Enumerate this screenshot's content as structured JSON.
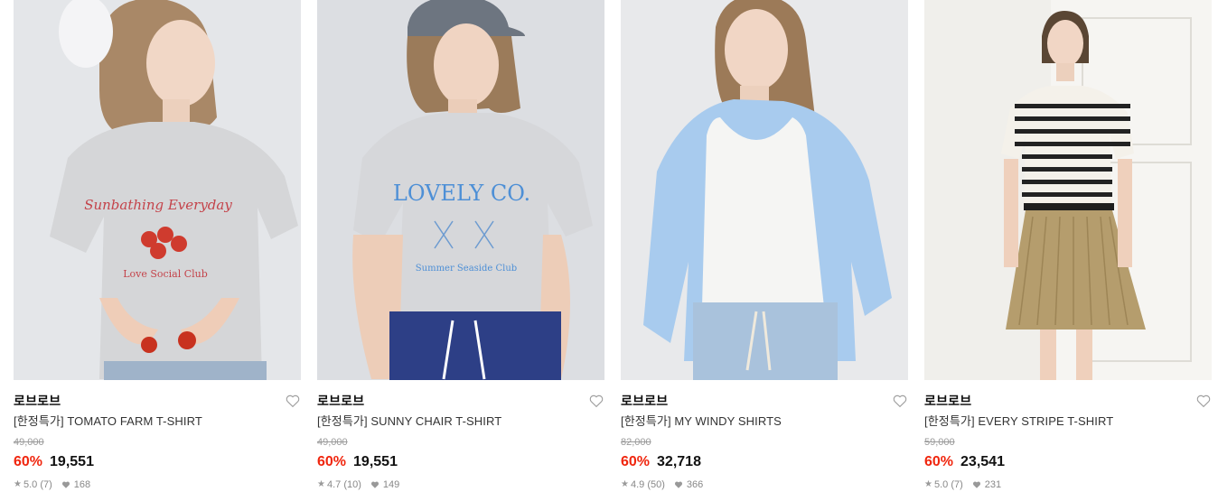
{
  "products": [
    {
      "brand": "로브로브",
      "title": "[한정특가] TOMATO FARM T-SHIRT",
      "original_price": "49,000",
      "discount": "60%",
      "price": "19,551",
      "rating": "5.0",
      "reviews": "(7)",
      "likes": "168",
      "image_alt": "model wearing grey tomato print t-shirt",
      "print_line1": "Sunbathing Everyday",
      "print_line2": "Love Social Club"
    },
    {
      "brand": "로브로브",
      "title": "[한정특가] SUNNY CHAIR T-SHIRT",
      "original_price": "49,000",
      "discount": "60%",
      "price": "19,551",
      "rating": "4.7",
      "reviews": "(10)",
      "likes": "149",
      "image_alt": "model wearing grey lovely co t-shirt with cap",
      "print_line1": "LOVELY CO.",
      "print_line2": "Summer Seaside Club"
    },
    {
      "brand": "로브로브",
      "title": "[한정특가] MY WINDY SHIRTS",
      "original_price": "82,000",
      "discount": "60%",
      "price": "32,718",
      "rating": "4.9",
      "reviews": "(50)",
      "likes": "366",
      "image_alt": "model wearing light blue shirt over white tank"
    },
    {
      "brand": "로브로브",
      "title": "[한정특가] EVERY STRIPE T-SHIRT",
      "original_price": "59,000",
      "discount": "60%",
      "price": "23,541",
      "rating": "5.0",
      "reviews": "(7)",
      "likes": "231",
      "image_alt": "model wearing striped t-shirt and pleated skirt"
    }
  ],
  "icons": {
    "wishlist": "heart-outline-icon",
    "rating": "star-icon",
    "likes": "heart-filled-icon"
  },
  "colors": {
    "discount": "#f0260e",
    "text": "#111111",
    "muted": "#9a9a9a"
  }
}
